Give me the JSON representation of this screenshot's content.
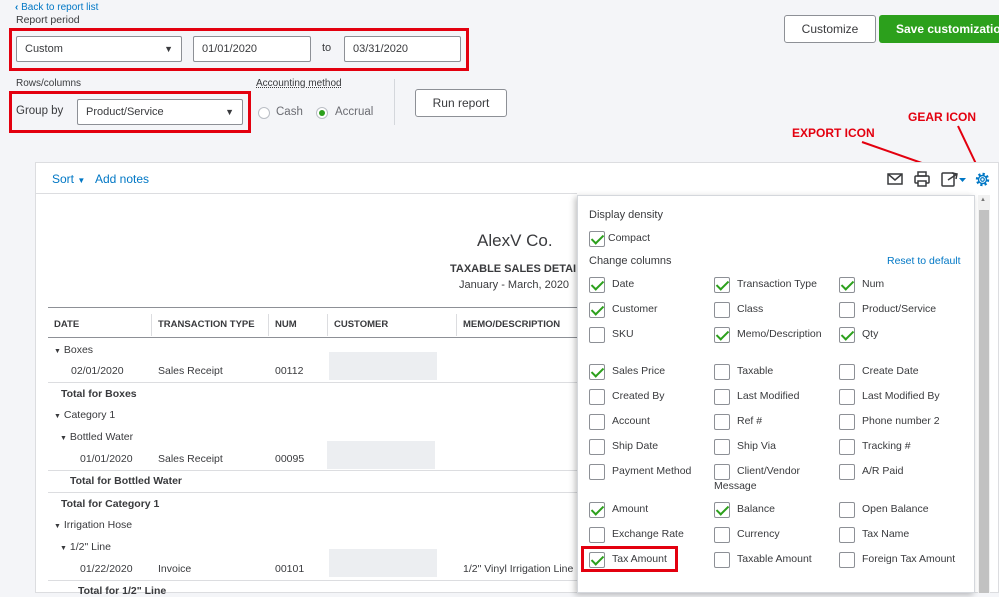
{
  "header": {
    "back_link": "Back to report list",
    "report_period_label": "Report period",
    "period_value": "Custom",
    "from_date": "01/01/2020",
    "to_label": "to",
    "to_date": "03/31/2020",
    "customize_label": "Customize",
    "save_label": "Save customization"
  },
  "controls": {
    "rows_columns_label": "Rows/columns",
    "group_by_label": "Group by",
    "group_by_value": "Product/Service",
    "accounting_method_label": "Accounting method",
    "cash_label": "Cash",
    "accrual_label": "Accrual",
    "selected_method": "Accrual",
    "run_report_label": "Run report"
  },
  "annotations": {
    "export_icon": "EXPORT ICON",
    "gear_icon": "GEAR ICON"
  },
  "toolbar": {
    "sort_label": "Sort",
    "add_notes_label": "Add notes",
    "icons": [
      "email-icon",
      "print-icon",
      "export-icon",
      "gear-icon"
    ]
  },
  "report": {
    "company": "AlexV Co.",
    "title": "TAXABLE SALES DETAI",
    "period": "January - March, 2020",
    "columns": [
      "DATE",
      "TRANSACTION TYPE",
      "NUM",
      "CUSTOMER",
      "MEMO/DESCRIPTION"
    ],
    "rows": [
      {
        "text": "Boxes"
      },
      {
        "date": "02/01/2020",
        "type": "Sales Receipt",
        "num": "00112",
        "memo": ""
      },
      {
        "text": "Total for Boxes"
      },
      {
        "text": "Category 1"
      },
      {
        "text": "Bottled Water"
      },
      {
        "date": "01/01/2020",
        "type": "Sales Receipt",
        "num": "00095",
        "memo": ""
      },
      {
        "text": "Total for Bottled Water"
      },
      {
        "text": "Total for Category 1"
      },
      {
        "text": "Irrigation Hose"
      },
      {
        "text": "1/2\" Line"
      },
      {
        "date": "01/22/2020",
        "type": "Invoice",
        "num": "00101",
        "memo": "1/2\" Vinyl Irrigation Line"
      },
      {
        "text": "Total for 1/2\" Line"
      }
    ]
  },
  "settings_panel": {
    "display_density_label": "Display density",
    "compact_label": "Compact",
    "change_columns_label": "Change columns",
    "reset_label": "Reset to default",
    "columns": [
      {
        "label": "Date",
        "checked": true
      },
      {
        "label": "Transaction Type",
        "checked": true
      },
      {
        "label": "Num",
        "checked": true
      },
      {
        "label": "Customer",
        "checked": true
      },
      {
        "label": "Class",
        "checked": false
      },
      {
        "label": "Product/Service",
        "checked": false
      },
      {
        "label": "SKU",
        "checked": false
      },
      {
        "label": "Memo/Description",
        "checked": true
      },
      {
        "label": "Qty",
        "checked": true
      },
      {
        "label": "Sales Price",
        "checked": true
      },
      {
        "label": "Taxable",
        "checked": false
      },
      {
        "label": "Create Date",
        "checked": false
      },
      {
        "label": "Created By",
        "checked": false
      },
      {
        "label": "Last Modified",
        "checked": false
      },
      {
        "label": "Last Modified By",
        "checked": false
      },
      {
        "label": "Account",
        "checked": false
      },
      {
        "label": "Ref #",
        "checked": false
      },
      {
        "label": "Phone number 2",
        "checked": false
      },
      {
        "label": "Ship Date",
        "checked": false
      },
      {
        "label": "Ship Via",
        "checked": false
      },
      {
        "label": "Tracking #",
        "checked": false
      },
      {
        "label": "Payment Method",
        "checked": false
      },
      {
        "label": "Client/Vendor Message",
        "checked": false
      },
      {
        "label": "A/R Paid",
        "checked": false
      },
      {
        "label": "Amount",
        "checked": true
      },
      {
        "label": "Balance",
        "checked": true
      },
      {
        "label": "Open Balance",
        "checked": false
      },
      {
        "label": "Exchange Rate",
        "checked": false
      },
      {
        "label": "Currency",
        "checked": false
      },
      {
        "label": "Tax Name",
        "checked": false
      },
      {
        "label": "Tax Amount",
        "checked": true
      },
      {
        "label": "Taxable Amount",
        "checked": false
      },
      {
        "label": "Foreign Tax Amount",
        "checked": false
      }
    ]
  },
  "colors": {
    "accent_green": "#2ca01c",
    "link_blue": "#0077c5",
    "highlight_red": "#e3000f"
  }
}
